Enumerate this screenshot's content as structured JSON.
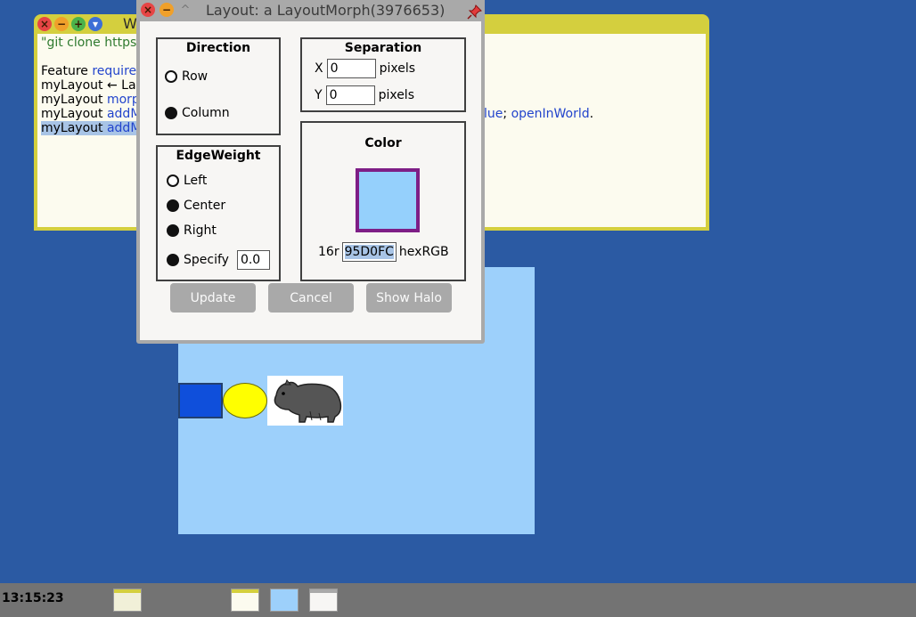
{
  "workspace": {
    "title": "W",
    "lines": [
      [
        {
          "t": "\"git clone https:",
          "c": "green"
        }
      ],
      [],
      [
        {
          "t": "Feature ",
          "c": "black"
        },
        {
          "t": "require",
          "c": "blue"
        }
      ],
      [
        {
          "t": "myLayout ← Lay",
          "c": "black"
        }
      ],
      [
        {
          "t": "myLayout ",
          "c": "black"
        },
        {
          "t": "morp",
          "c": "blue"
        }
      ],
      [
        {
          "t": "myLayout ",
          "c": "black"
        },
        {
          "t": "addM",
          "c": "blue"
        }
      ],
      [
        {
          "t": "myLayout ",
          "c": "sel"
        },
        {
          "t": "addM",
          "c": "selblue"
        }
      ]
    ],
    "line4_tail": [
      {
        "t": "lue",
        "c": "blue"
      },
      {
        "t": "; ",
        "c": "black"
      },
      {
        "t": "openInWorld",
        "c": "blue"
      },
      {
        "t": ".",
        "c": "black"
      }
    ]
  },
  "dialog": {
    "title": "Layout: a LayoutMorph(3976653)",
    "direction": {
      "title": "Direction",
      "options": [
        {
          "label": "Row",
          "selected": false
        },
        {
          "label": "Column",
          "selected": true
        }
      ]
    },
    "separation": {
      "title": "Separation",
      "x_label": "X",
      "x_value": "0",
      "y_label": "Y",
      "y_value": "0",
      "unit": "pixels"
    },
    "edge_weight": {
      "title": "EdgeWeight",
      "options": [
        {
          "label": "Left",
          "selected": false
        },
        {
          "label": "Center",
          "selected": true
        },
        {
          "label": "Right",
          "selected": true
        },
        {
          "label": "Specify",
          "selected": true
        }
      ],
      "specify_value": "0.0"
    },
    "color": {
      "title": "Color",
      "swatch": "#95D0FC",
      "border": "#7E1E86",
      "prefix": "16r",
      "hex_value": "95D0FC",
      "suffix": "hexRGB"
    },
    "buttons": {
      "update": "Update",
      "cancel": "Cancel",
      "show_halo": "Show Halo"
    }
  },
  "taskbar": {
    "clock": "13:15:23"
  },
  "colors": {
    "desktop": "#2b5aa3",
    "morph_fill": "#9dd0fb",
    "rect_fill": "#0f4fdb",
    "ellipse_fill": "#ffff00",
    "workspace_frame": "#d4cf3e"
  }
}
